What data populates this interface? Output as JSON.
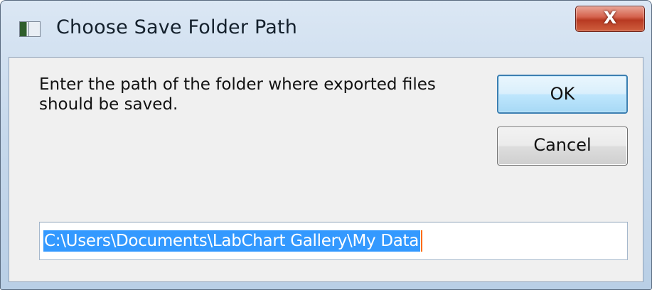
{
  "window": {
    "title": "Choose Save Folder Path",
    "close_label": "X"
  },
  "dialog": {
    "prompt": "Enter the path of the folder where exported files should be saved.",
    "ok_label": "OK",
    "cancel_label": "Cancel",
    "path_value": "C:\\Users\\Documents\\LabChart Gallery\\My Data"
  },
  "icons": {
    "app": "window-app-icon",
    "close": "close-icon"
  },
  "colors": {
    "selection": "#3399ff",
    "close_button": "#c8452c",
    "ok_border": "#3c7fb1"
  }
}
